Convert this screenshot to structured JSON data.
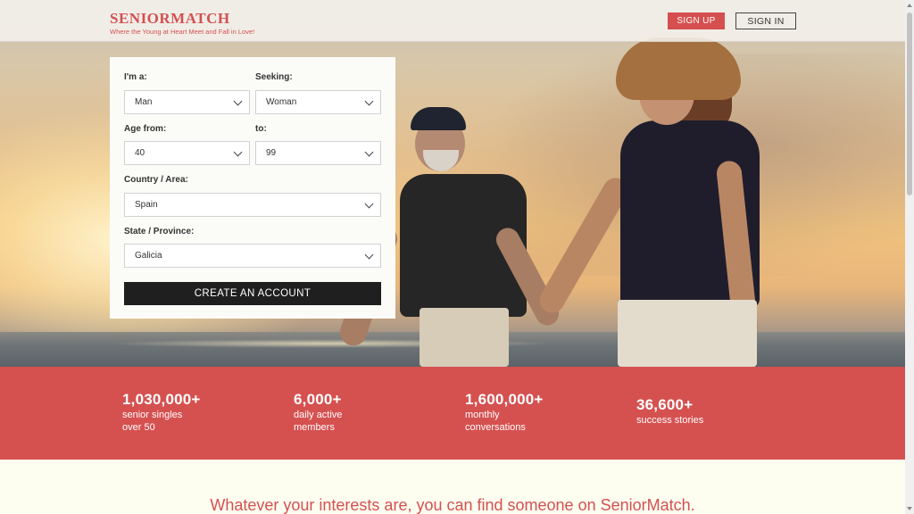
{
  "header": {
    "logo": "SENIORMATCH",
    "tagline": "Where the Young at Heart Meet and Fall in Love!",
    "signup_label": "SIGN UP",
    "signin_label": "SIGN IN"
  },
  "form": {
    "i_am_label": "I'm a:",
    "i_am_value": "Man",
    "seeking_label": "Seeking:",
    "seeking_value": "Woman",
    "age_from_label": "Age from:",
    "age_from_value": "40",
    "age_to_label": "to:",
    "age_to_value": "99",
    "country_label": "Country / Area:",
    "country_value": "Spain",
    "state_label": "State / Province:",
    "state_value": "Galicia",
    "submit_label": "CREATE AN ACCOUNT"
  },
  "stats": [
    {
      "number": "1,030,000+",
      "text": "senior singles over 50"
    },
    {
      "number": "6,000+",
      "text": "daily active members"
    },
    {
      "number": "1,600,000+",
      "text": "monthly conversations"
    },
    {
      "number": "36,600+",
      "text": "success stories"
    }
  ],
  "section": {
    "headline": "Whatever your interests are, you can find someone on SeniorMatch."
  },
  "colors": {
    "brand": "#d55150",
    "dark_button": "#1f1f1f"
  }
}
